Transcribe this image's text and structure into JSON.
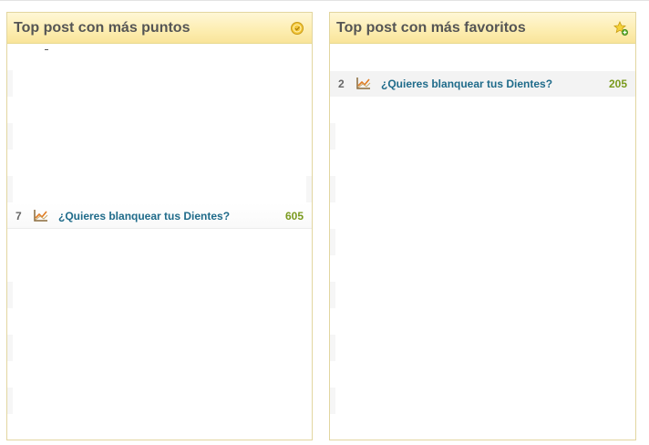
{
  "panels": {
    "points": {
      "title": "Top post con más puntos",
      "icon": "coin-icon",
      "posts": [
        {
          "rank": "7",
          "title": "¿Quieres blanquear tus Dientes?",
          "score": "605",
          "icon": "chart-icon"
        }
      ]
    },
    "favorites": {
      "title": "Top post con más favoritos",
      "icon": "star-add-icon",
      "posts": [
        {
          "rank": "2",
          "title": "¿Quieres blanquear tus Dientes?",
          "score": "205",
          "icon": "chart-icon"
        }
      ]
    }
  },
  "colors": {
    "header_gradient_top": "#fff7d6",
    "header_gradient_bottom": "#f9e49a",
    "border": "#e2d6a0",
    "link": "#1f6b8a",
    "score": "#7a9a1e"
  }
}
